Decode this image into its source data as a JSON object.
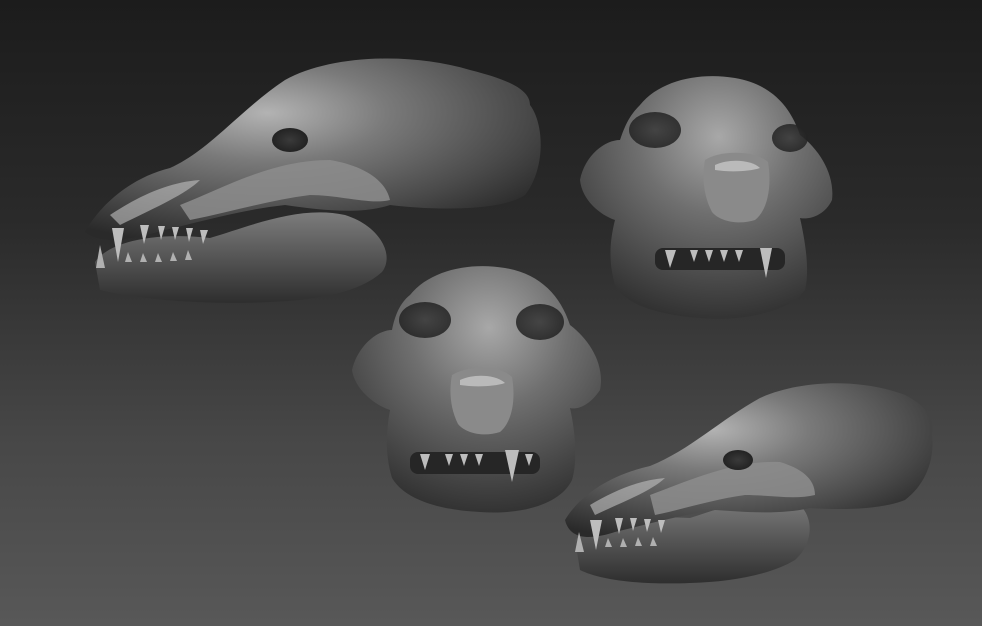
{
  "scene": {
    "subject": "skull-turnaround",
    "views": [
      {
        "id": "side-left-top",
        "label": ""
      },
      {
        "id": "front-top-right",
        "label": ""
      },
      {
        "id": "front-center",
        "label": ""
      },
      {
        "id": "side-bottom-right",
        "label": ""
      }
    ],
    "colors": {
      "background_top": "#1c1c1c",
      "background_bottom": "#585858",
      "clay_light": "#a9a9a9",
      "clay_mid": "#6e6e6e",
      "clay_dark": "#2e2e2e",
      "teeth": "#bdbdbd"
    }
  }
}
